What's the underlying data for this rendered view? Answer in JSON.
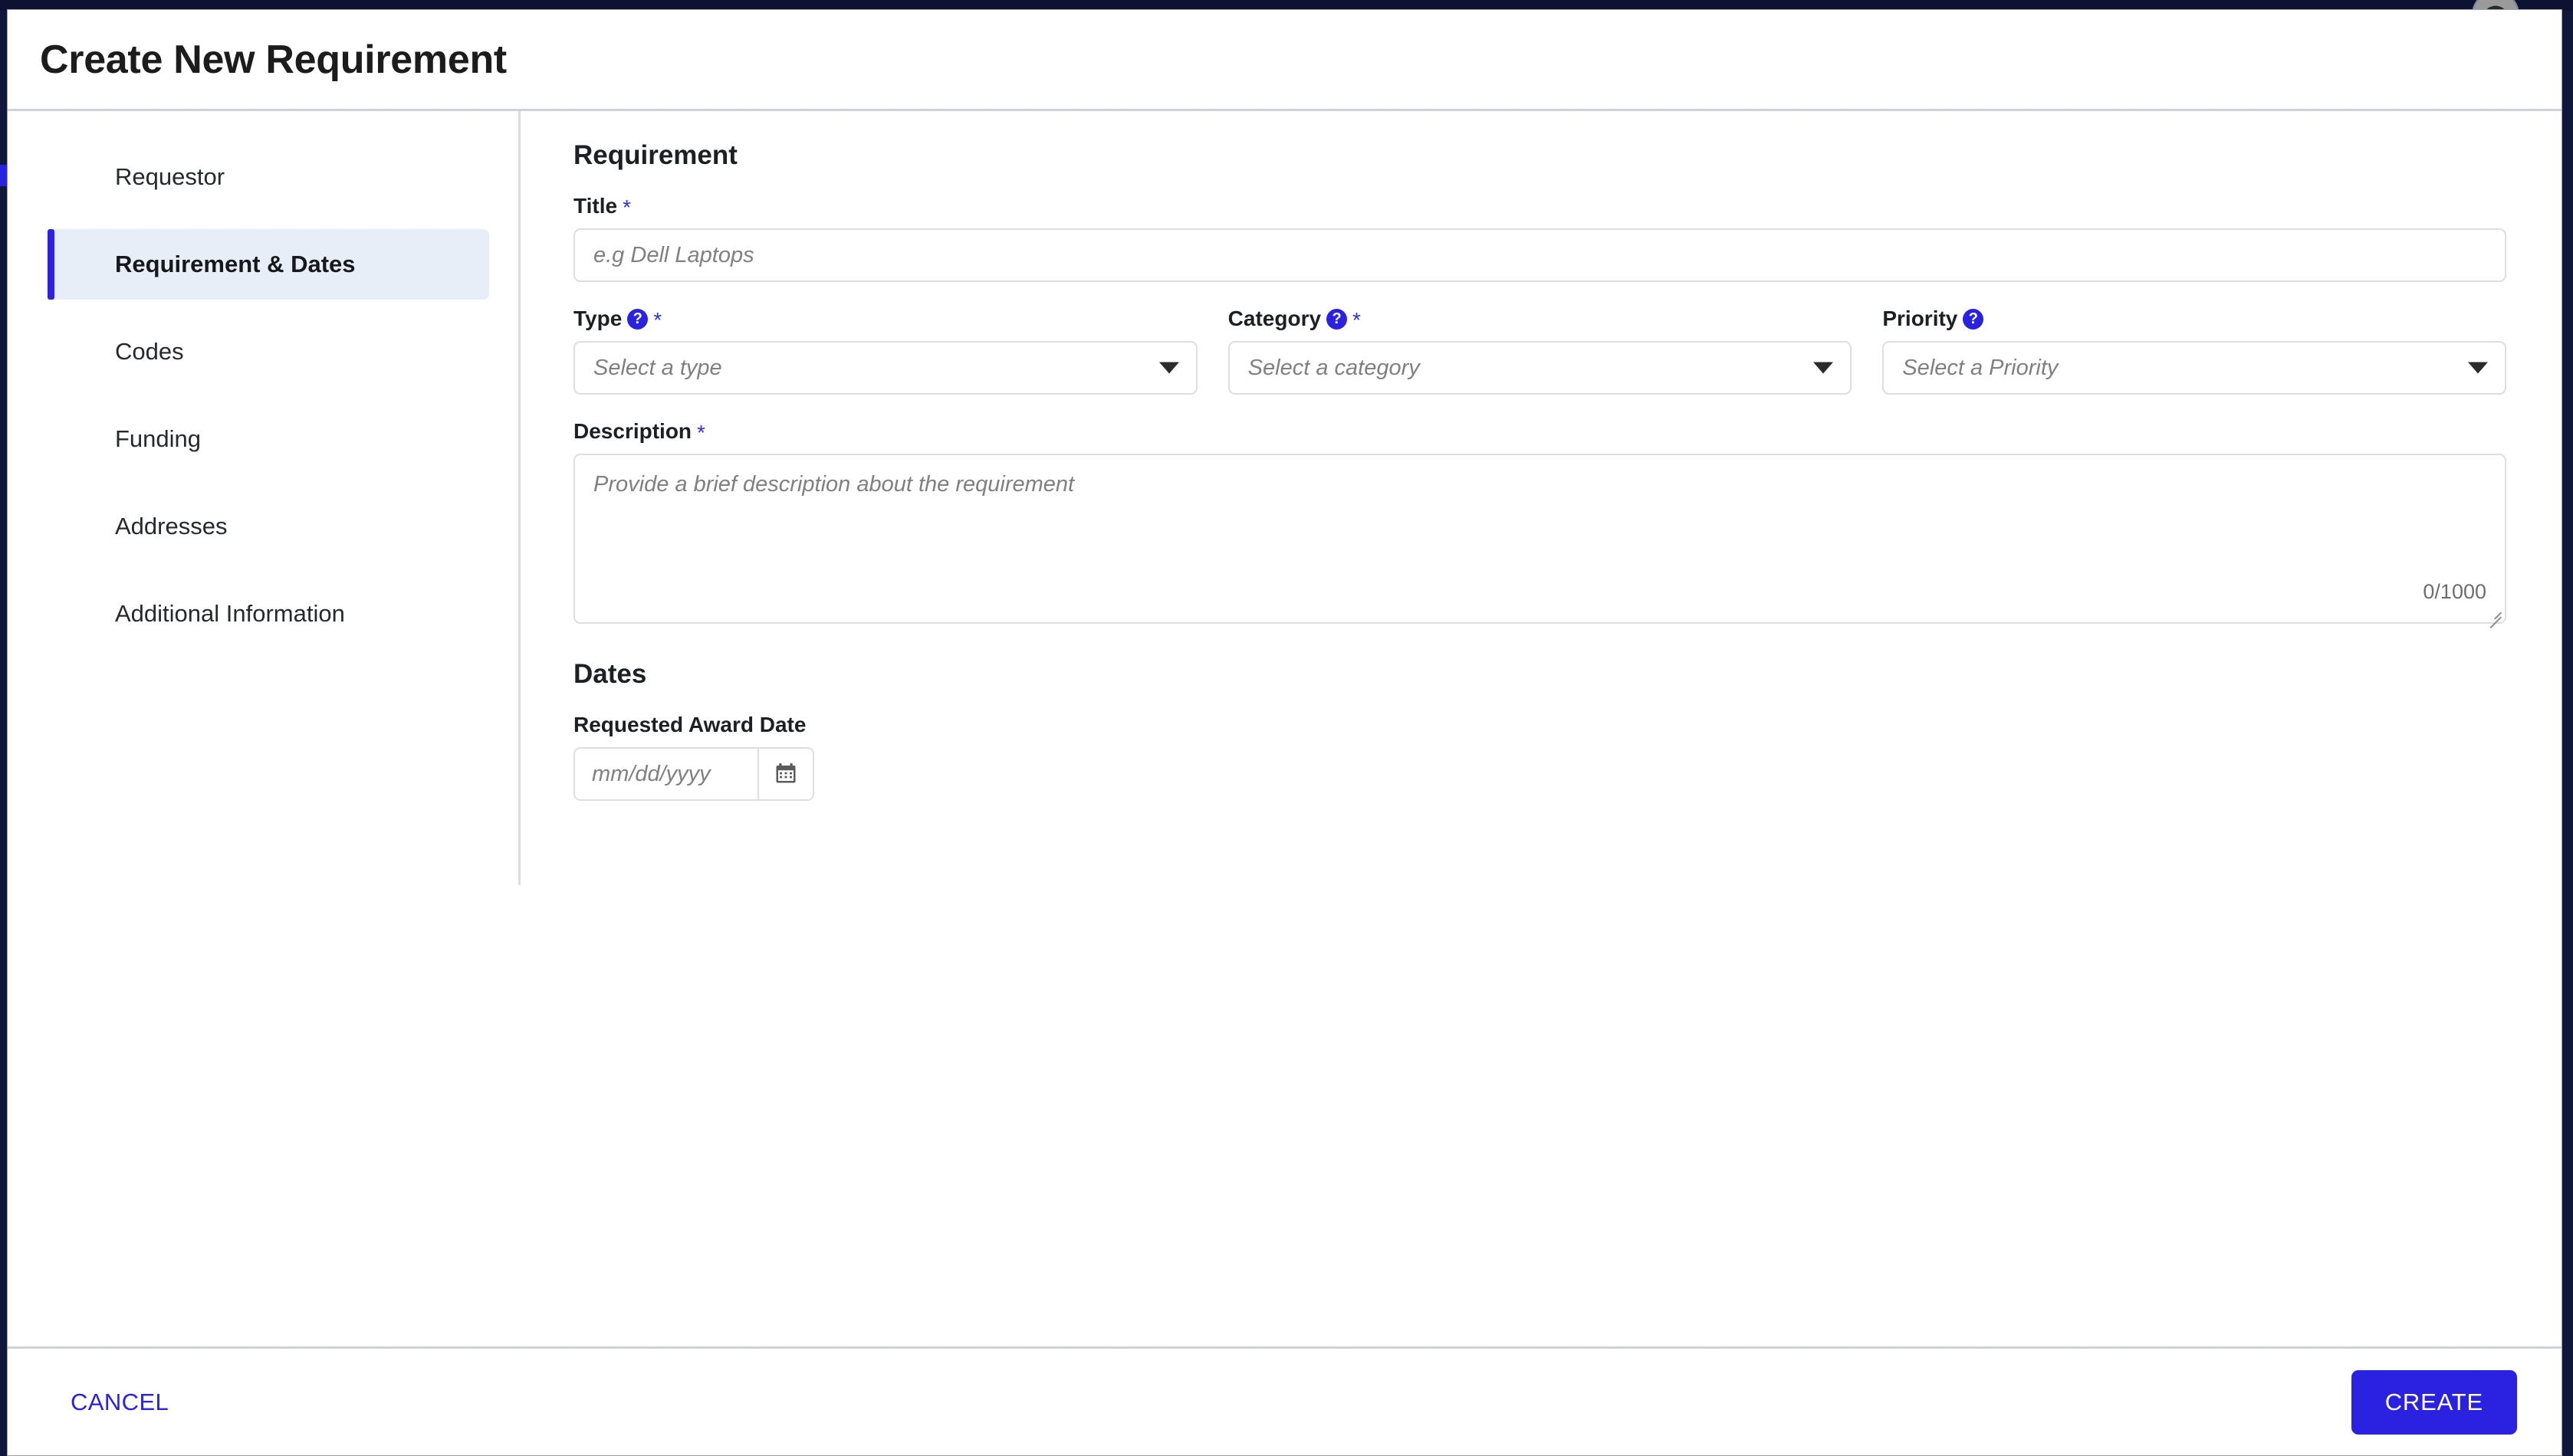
{
  "window": {
    "title": "Create New Requirement"
  },
  "theme": {
    "accent": "#2a22e0",
    "active_nav_bg": "#e7eef8",
    "backdrop": "#11173a",
    "border": "#dcdee1",
    "placeholder": "#808080"
  },
  "sidebar": {
    "items": [
      {
        "label": "Requestor",
        "active": false
      },
      {
        "label": "Requirement & Dates",
        "active": true
      },
      {
        "label": "Codes",
        "active": false
      },
      {
        "label": "Funding",
        "active": false
      },
      {
        "label": "Addresses",
        "active": false
      },
      {
        "label": "Additional Information",
        "active": false
      }
    ]
  },
  "content": {
    "requirement_heading": "Requirement",
    "title_field": {
      "label": "Title",
      "required_mark": "*",
      "value": "",
      "placeholder": "e.g Dell Laptops"
    },
    "type_field": {
      "label": "Type",
      "help_glyph": "?",
      "required_mark": "*",
      "value": "Select a type"
    },
    "category_field": {
      "label": "Category",
      "help_glyph": "?",
      "required_mark": "*",
      "value": "Select a category"
    },
    "priority_field": {
      "label": "Priority",
      "help_glyph": "?",
      "required_mark": "",
      "value": "Select a Priority"
    },
    "description_field": {
      "label": "Description",
      "required_mark": "*",
      "value": "",
      "placeholder": "Provide a brief description about the requirement",
      "counter": "0/1000"
    },
    "dates_heading": "Dates",
    "award_date_field": {
      "label": "Requested Award Date",
      "value": "",
      "placeholder": "mm/dd/yyyy",
      "calendar_icon": "calendar-icon"
    }
  },
  "footer": {
    "cancel_label": "CANCEL",
    "create_label": "CREATE"
  }
}
